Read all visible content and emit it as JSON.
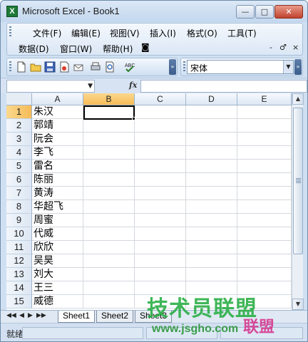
{
  "window": {
    "title": "Microsoft Excel - Book1",
    "app_icon_text": "X",
    "min_glyph": "—",
    "max_glyph": "□",
    "close_glyph": "✕"
  },
  "menu": {
    "row1": [
      "文件(F)",
      "编辑(E)",
      "视图(V)",
      "插入(I)",
      "格式(O)",
      "工具(T)"
    ],
    "row2": [
      "数据(D)",
      "窗口(W)",
      "帮助(H)"
    ],
    "mdi_controls": [
      "-",
      "♂",
      "×"
    ]
  },
  "toolbar": {
    "icons": [
      "new-icon",
      "open-icon",
      "save-icon",
      "permission-icon",
      "email-icon",
      "print-icon",
      "print-preview-icon",
      "spelling-icon"
    ],
    "font_name": "宋体"
  },
  "formula_bar": {
    "name_box": "",
    "fx_label": "fx",
    "formula": ""
  },
  "sheet": {
    "columns": [
      "A",
      "B",
      "C",
      "D",
      "E"
    ],
    "selected_column": "B",
    "selected_row": "1",
    "rows": [
      {
        "num": "1",
        "a": "朱汉"
      },
      {
        "num": "2",
        "a": "郭靖"
      },
      {
        "num": "3",
        "a": "阮会"
      },
      {
        "num": "4",
        "a": "李飞"
      },
      {
        "num": "5",
        "a": "雷名"
      },
      {
        "num": "6",
        "a": "陈丽"
      },
      {
        "num": "7",
        "a": "黄涛"
      },
      {
        "num": "8",
        "a": "华超飞"
      },
      {
        "num": "9",
        "a": "周蜜"
      },
      {
        "num": "10",
        "a": "代威"
      },
      {
        "num": "11",
        "a": "欣欣"
      },
      {
        "num": "12",
        "a": "吴昊"
      },
      {
        "num": "13",
        "a": "刘大"
      },
      {
        "num": "14",
        "a": "王三"
      },
      {
        "num": "15",
        "a": "威德"
      }
    ]
  },
  "tabs": {
    "nav": [
      "◀◀",
      "◀",
      "▶",
      "▶▶"
    ],
    "sheets": [
      "Sheet1",
      "Sheet2",
      "Sheet3"
    ]
  },
  "status": {
    "text": "就绪"
  },
  "watermark": {
    "main": "技术员联盟",
    "url": "www.jsgho.com",
    "logo": "联盟"
  }
}
